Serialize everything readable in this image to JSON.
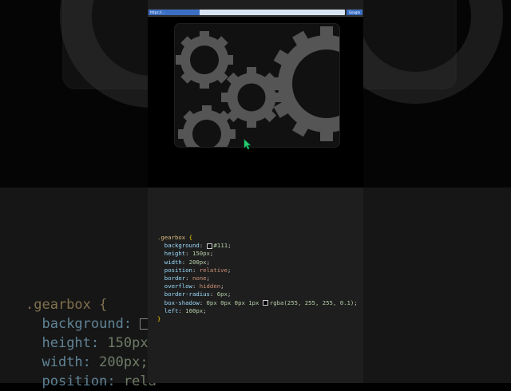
{
  "browser": {
    "url": "https://...",
    "search_button": "Google"
  },
  "code": {
    "selector": ".gearbox",
    "open_brace": "{",
    "close_brace": "}",
    "lines": [
      {
        "prop": "background",
        "value": "#111",
        "swatch": "#111111",
        "kind": "num"
      },
      {
        "prop": "height",
        "value": "150px",
        "kind": "num"
      },
      {
        "prop": "width",
        "value": "200px",
        "kind": "num"
      },
      {
        "prop": "position",
        "value": "relative",
        "kind": "val"
      },
      {
        "prop": "border",
        "value": "none",
        "kind": "val"
      },
      {
        "prop": "overflow",
        "value": "hidden",
        "kind": "val"
      },
      {
        "prop": "border-radius",
        "value": "6px",
        "kind": "num"
      },
      {
        "prop": "box-shadow",
        "value": "0px 0px 0px 1px",
        "value2": "rgba(255, 255, 255, 0.1)",
        "swatch": "#000000",
        "kind": "num"
      },
      {
        "prop": "left",
        "value": "100px",
        "kind": "num"
      }
    ]
  },
  "background_code": {
    "selector": ".gearbox {",
    "lines": [
      {
        "prop": "background:",
        "value": ""
      },
      {
        "prop": "height:",
        "value": "150px;"
      },
      {
        "prop": "width:",
        "value": "200px;"
      },
      {
        "prop": "position:",
        "value": "rela"
      }
    ]
  },
  "colors": {
    "gear": "#555555",
    "gear_dark": "#3a3a3a",
    "cursor": "#2ecc71"
  },
  "icons": {
    "cursor": "cursor-arrow-icon"
  }
}
